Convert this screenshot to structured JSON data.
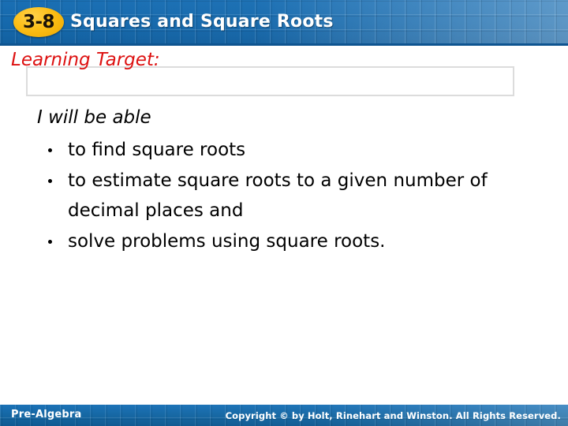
{
  "header": {
    "lesson_badge": "3-8",
    "title": "Squares and Square Roots",
    "badge_color": "#fcbe16",
    "bar_color": "#1568ab",
    "title_color": "#ffffff"
  },
  "content": {
    "target_heading": "Learning Target:",
    "target_heading_color": "#dd1111",
    "lead_line": "I will be able",
    "bullets": [
      {
        "text": "to find square roots"
      },
      {
        "text": "to estimate square roots to a given number of decimal places and"
      },
      {
        "text": "solve problems using square roots."
      }
    ]
  },
  "footer": {
    "course": "Pre-Algebra",
    "copyright": "Copyright © by Holt, Rinehart and Winston. All Rights Reserved.",
    "bar_color": "#13649f"
  }
}
